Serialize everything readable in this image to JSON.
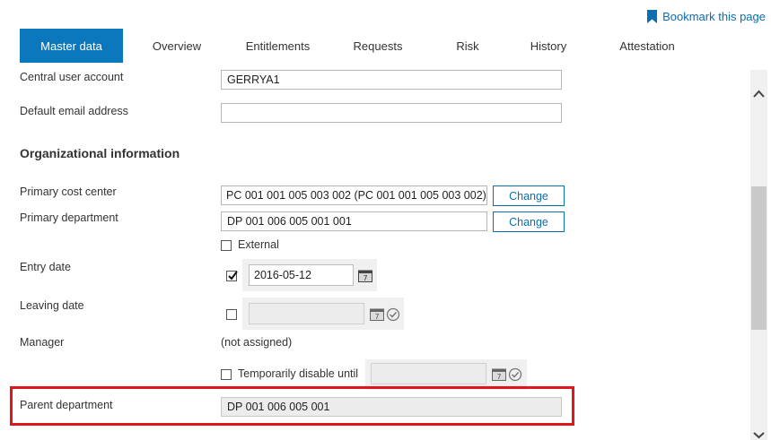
{
  "bookmark": {
    "label": "Bookmark this page"
  },
  "tabs": [
    {
      "label": "Master data",
      "active": true
    },
    {
      "label": "Overview",
      "active": false
    },
    {
      "label": "Entitlements",
      "active": false
    },
    {
      "label": "Requests",
      "active": false
    },
    {
      "label": "Risk",
      "active": false
    },
    {
      "label": "History",
      "active": false
    },
    {
      "label": "Attestation",
      "active": false
    }
  ],
  "form": {
    "central_user_account": {
      "label": "Central user account",
      "value": "GERRYA1"
    },
    "default_email": {
      "label": "Default email address",
      "value": ""
    },
    "org_section_title": "Organizational information",
    "primary_cost_center": {
      "label": "Primary cost center",
      "value": "PC 001 001 005 003 002 (PC 001 001 005 003 002)",
      "button": "Change"
    },
    "primary_department": {
      "label": "Primary department",
      "value": "DP 001 006 005 001 001",
      "button": "Change"
    },
    "external": {
      "label": "External",
      "checked": false
    },
    "entry_date": {
      "label": "Entry date",
      "checked": true,
      "value": "2016-05-12"
    },
    "leaving_date": {
      "label": "Leaving date",
      "checked": false,
      "value": ""
    },
    "manager": {
      "label": "Manager",
      "value": "(not assigned)"
    },
    "temp_disable": {
      "label": "Temporarily disable until",
      "checked": false,
      "value": ""
    },
    "parent_department": {
      "label": "Parent department",
      "value": "DP 001 006 005 001"
    }
  },
  "colors": {
    "accent": "#0b78bd",
    "link": "#0b6eb0",
    "highlight": "#e0161b"
  }
}
